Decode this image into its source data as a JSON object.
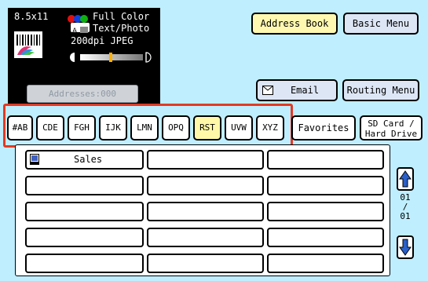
{
  "status": {
    "paper_size": "8.5x11",
    "color_mode": "Full Color",
    "image_mode": "Text/Photo",
    "resolution": "200dpi JPEG",
    "addresses": "Addresses:000"
  },
  "top_buttons": {
    "address_book": "Address Book",
    "basic_menu": "Basic Menu",
    "email": "Email",
    "routing_menu": "Routing Menu"
  },
  "tabs": [
    {
      "label": "#AB",
      "selected": false
    },
    {
      "label": "CDE",
      "selected": false
    },
    {
      "label": "FGH",
      "selected": false
    },
    {
      "label": "IJK",
      "selected": false
    },
    {
      "label": "LMN",
      "selected": false
    },
    {
      "label": "OPQ",
      "selected": false
    },
    {
      "label": "RST",
      "selected": true
    },
    {
      "label": "UVW",
      "selected": false
    },
    {
      "label": "XYZ",
      "selected": false
    }
  ],
  "favorites_label": "Favorites",
  "sd_card_label": [
    "SD Card /",
    "Hard Drive"
  ],
  "entries": [
    "Sales",
    "",
    "",
    "",
    "",
    "",
    "",
    "",
    "",
    "",
    "",
    "",
    "",
    "",
    ""
  ],
  "pagination": {
    "current": "01",
    "separator": "/",
    "total": "01"
  },
  "colors": {
    "background": "#bfeeff",
    "selected_tab": "#fff8a8",
    "highlight": "#e23a24",
    "address_book": "#fff8b0"
  }
}
